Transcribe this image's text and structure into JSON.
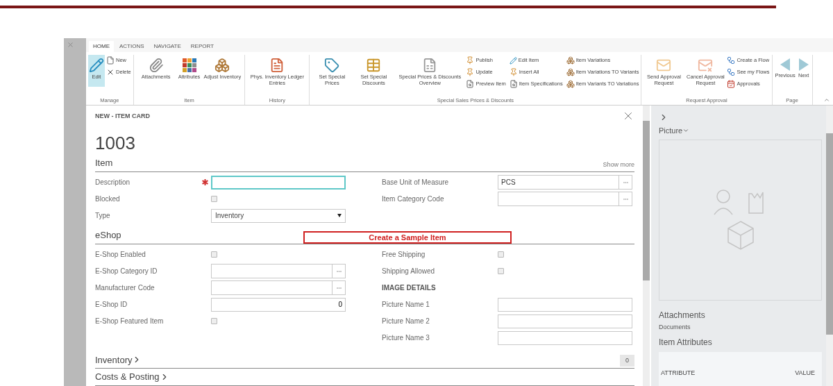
{
  "ribbon": {
    "tabs": [
      {
        "label": "HOME",
        "selected": true
      },
      {
        "label": "ACTIONS",
        "selected": false
      },
      {
        "label": "NAVIGATE",
        "selected": false
      },
      {
        "label": "REPORT",
        "selected": false
      }
    ],
    "groups": [
      {
        "label": "Manage",
        "items": [
          {
            "label": "Edit",
            "kind": "large",
            "highlighted": true
          },
          {
            "label": "New",
            "kind": "small",
            "highlighted": false
          },
          {
            "label": "Delete",
            "kind": "small",
            "highlighted": false
          }
        ]
      },
      {
        "label": "Item",
        "items": [
          {
            "label": "Attachments",
            "kind": "large",
            "highlighted": false
          },
          {
            "label": "Attributes",
            "kind": "large",
            "highlighted": false
          },
          {
            "label": "Adjust Inventory",
            "kind": "large",
            "highlighted": false
          }
        ]
      },
      {
        "label": "History",
        "items": [
          {
            "label": "Phys. Inventory Ledger Entries",
            "kind": "large",
            "highlighted": false
          }
        ]
      },
      {
        "label": "Special Sales Prices & Discounts",
        "items": [
          {
            "label": "Set Special Prices",
            "kind": "large",
            "highlighted": false
          },
          {
            "label": "Set Special Discounts",
            "kind": "large",
            "highlighted": false
          },
          {
            "label": "Special Prices & Discounts Overview",
            "kind": "large",
            "highlighted": false
          },
          {
            "label": "Publish",
            "kind": "small",
            "highlighted": false
          },
          {
            "label": "Update",
            "kind": "small",
            "highlighted": false
          },
          {
            "label": "Preview Item",
            "kind": "small",
            "highlighted": false
          },
          {
            "label": "Edit Item",
            "kind": "small",
            "highlighted": false
          },
          {
            "label": "Insert All",
            "kind": "small",
            "highlighted": false
          },
          {
            "label": "Item Specifications",
            "kind": "small",
            "highlighted": false
          },
          {
            "label": "Item Variations",
            "kind": "small",
            "highlighted": false
          },
          {
            "label": "Item Variations TO Variants",
            "kind": "small",
            "highlighted": false
          },
          {
            "label": "Item Variants TO Variations",
            "kind": "small",
            "highlighted": false
          }
        ]
      },
      {
        "label": "Request Approval",
        "items": [
          {
            "label": "Send Approval Request",
            "kind": "large",
            "highlighted": false
          },
          {
            "label": "Cancel Approval Request",
            "kind": "large",
            "highlighted": false
          },
          {
            "label": "Create a Flow",
            "kind": "small",
            "highlighted": false
          },
          {
            "label": "See my Flows",
            "kind": "small",
            "highlighted": false
          },
          {
            "label": "Approvals",
            "kind": "small",
            "highlighted": false
          }
        ]
      },
      {
        "label": "Page",
        "items": [
          {
            "label": "Previous",
            "kind": "large",
            "highlighted": false
          },
          {
            "label": "Next",
            "kind": "large",
            "highlighted": false
          }
        ]
      }
    ]
  },
  "card": {
    "caption": "NEW - ITEM CARD",
    "number": "1003",
    "sections": [
      {
        "title": "Item",
        "show_more": "Show more",
        "columns": [
          [
            {
              "label": "Description",
              "kind": "text",
              "required": true,
              "focused": true
            },
            {
              "label": "Blocked",
              "kind": "checkbox",
              "checked": false
            },
            {
              "label": "Type",
              "kind": "select",
              "value": "Inventory"
            }
          ],
          [
            {
              "label": "Base Unit of Measure",
              "kind": "lookup",
              "value": "PCS"
            },
            {
              "label": "Item Category Code",
              "kind": "lookup"
            }
          ]
        ]
      },
      {
        "title": "eShop",
        "annotation": "Create a Sample Item",
        "columns": [
          [
            {
              "label": "E-Shop Enabled",
              "kind": "checkbox",
              "checked": false
            },
            {
              "label": "E-Shop Category ID",
              "kind": "lookup"
            },
            {
              "label": "Manufacturer Code",
              "kind": "lookup"
            },
            {
              "label": "E-Shop ID",
              "kind": "number",
              "value": "0"
            },
            {
              "label": "E-Shop Featured Item",
              "kind": "checkbox",
              "checked": false
            }
          ],
          [
            {
              "label": "Free Shipping",
              "kind": "checkbox",
              "checked": false
            },
            {
              "label": "Shipping Allowed",
              "kind": "checkbox",
              "checked": false
            },
            {
              "label": "IMAGE DETAILS",
              "kind": "heading"
            },
            {
              "label": "Picture Name 1",
              "kind": "text"
            },
            {
              "label": "Picture Name 2",
              "kind": "text"
            },
            {
              "label": "Picture Name 3",
              "kind": "text"
            }
          ]
        ]
      }
    ],
    "collapsed": [
      {
        "title": "Inventory",
        "count": "0"
      },
      {
        "title": "Costs & Posting"
      }
    ]
  },
  "factbox": {
    "picture_title": "Picture",
    "attachments_title": "Attachments",
    "attachments_link": "Documents",
    "attributes_title": "Item Attributes",
    "attribute_columns": [
      "ATTRIBUTE",
      "VALUE"
    ]
  }
}
